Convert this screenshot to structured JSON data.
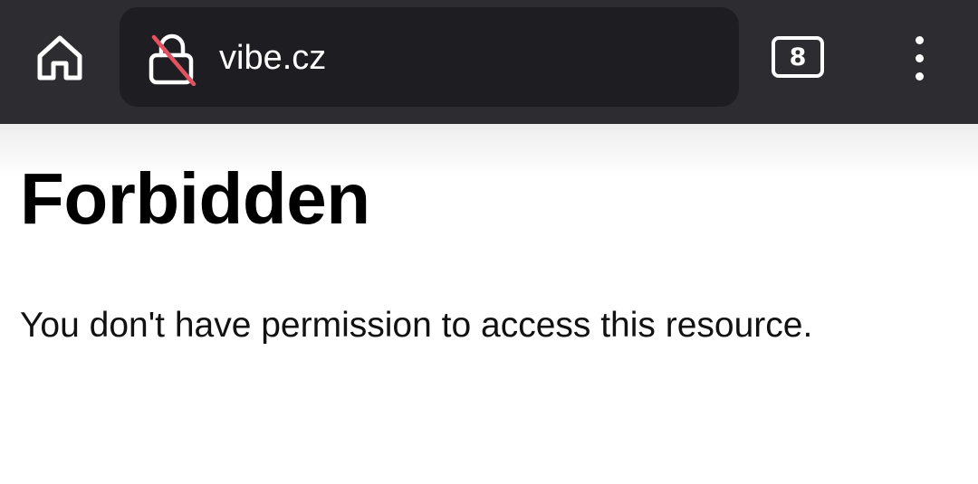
{
  "browser": {
    "home_icon": "home-icon",
    "security_icon": "insecure-lock-icon",
    "url": "vibe.cz",
    "tab_count": "8",
    "menu_icon": "more-vertical-icon",
    "colors": {
      "toolbar": "#2c2c31",
      "urlbar": "#1e1e22",
      "insecure_slash": "#e25260"
    }
  },
  "page": {
    "heading": "Forbidden",
    "message": "You don't have permission to access this resource."
  }
}
